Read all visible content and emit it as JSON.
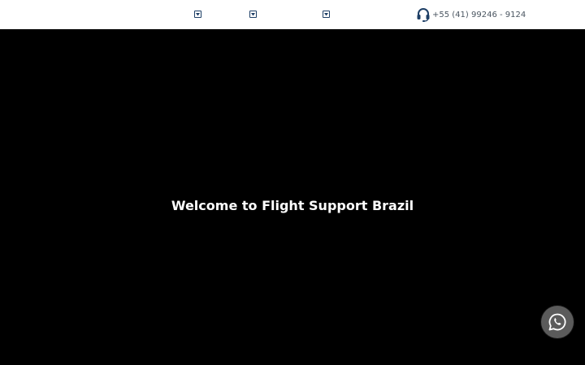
{
  "header": {
    "nav_dropdowns": [
      {
        "icon": "dropdown-arrow-icon"
      },
      {
        "icon": "dropdown-arrow-icon"
      },
      {
        "icon": "dropdown-arrow-icon"
      }
    ],
    "phone": {
      "icon": "headset-icon",
      "number": "+55 (41) 99246 - 9124"
    }
  },
  "hero": {
    "title": "Welcome to Flight Support Brazil"
  },
  "floating": {
    "whatsapp_icon": "whatsapp-icon"
  },
  "colors": {
    "nav_background": "#ffffff",
    "accent": "#1e3f66",
    "hero_background": "#000000",
    "whatsapp_button": "#5b5b5b"
  }
}
